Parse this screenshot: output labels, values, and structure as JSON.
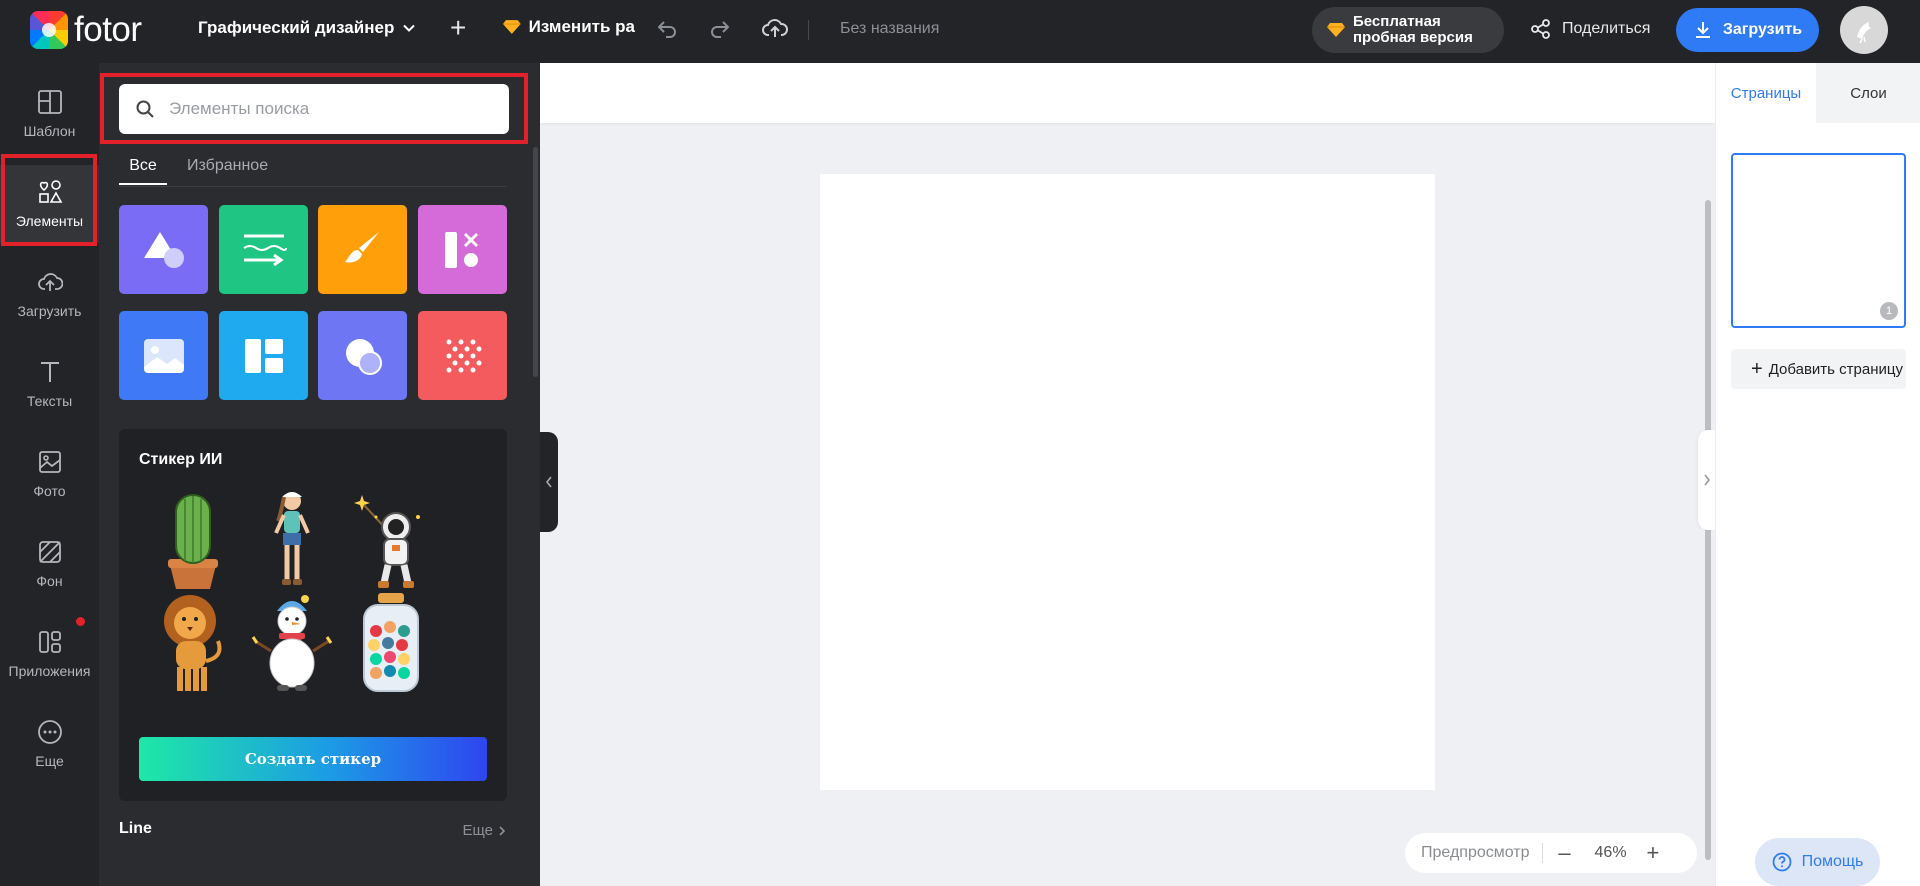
{
  "topbar": {
    "logo_text": "fotor",
    "doc_type": "Графический дизайнер",
    "resize_label": "Изменить ра",
    "doc_title": "Без названия",
    "trial_line1": "Бесплатная",
    "trial_line2": "пробная версия",
    "share_label": "Поделиться",
    "upload_label": "Загрузить"
  },
  "rail": {
    "items": [
      {
        "label": "Шаблон",
        "icon": "template-icon"
      },
      {
        "label": "Элементы",
        "icon": "elements-icon"
      },
      {
        "label": "Загрузить",
        "icon": "upload-icon"
      },
      {
        "label": "Тексты",
        "icon": "text-icon"
      },
      {
        "label": "Фото",
        "icon": "photo-icon"
      },
      {
        "label": "Фон",
        "icon": "background-icon"
      },
      {
        "label": "Приложения",
        "icon": "apps-icon"
      },
      {
        "label": "Еще",
        "icon": "more-icon"
      }
    ]
  },
  "panel": {
    "search_placeholder": "Элементы поиска",
    "tab_all": "Все",
    "tab_favorites": "Избранное",
    "categories": [
      {
        "name": "shapes",
        "color": "#7b6cf6"
      },
      {
        "name": "lines",
        "color": "#1fc582"
      },
      {
        "name": "illustrations",
        "color": "#ff9f0a"
      },
      {
        "name": "icons",
        "color": "#d46bd9"
      },
      {
        "name": "frames",
        "color": "#3f79f5"
      },
      {
        "name": "grids",
        "color": "#1fa9ef"
      },
      {
        "name": "stickers",
        "color": "#6f76f4"
      },
      {
        "name": "patterns",
        "color": "#f45b5f"
      }
    ],
    "sticker_section_title": "Стикер ИИ",
    "create_sticker_label": "Создать стикер",
    "line_section_title": "Line",
    "more_label": "Еще"
  },
  "canvas": {
    "preview_label": "Предпросмотр",
    "zoom_level": "46%"
  },
  "right_panel": {
    "tab_pages": "Страницы",
    "tab_layers": "Слои",
    "page_number": "1",
    "add_page_label": "Добавить страницу"
  },
  "help_label": "Помощь",
  "colors": {
    "accent": "#2f7bf5",
    "highlight": "#e3212b",
    "dark_bg": "#232427",
    "panel_bg": "#2b2c30"
  }
}
